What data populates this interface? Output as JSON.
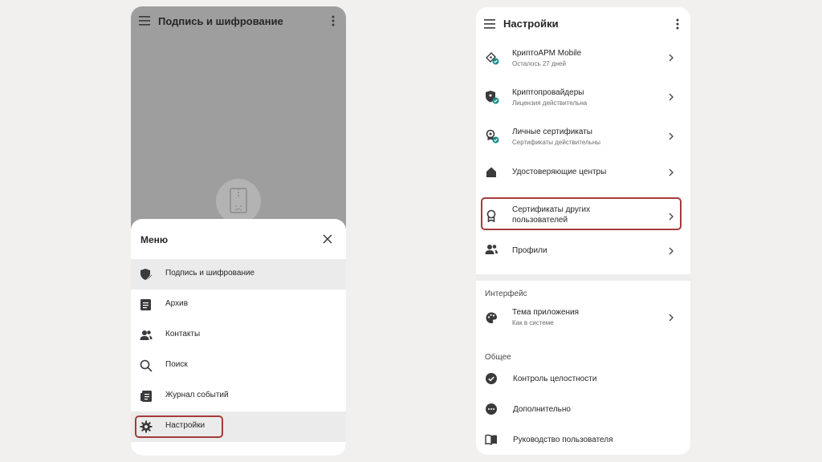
{
  "left": {
    "header": {
      "title": "Подпись и шифрование"
    },
    "menu": {
      "title": "Меню",
      "items": [
        {
          "label": "Подпись и шифрование",
          "icon": "shield-pen-icon"
        },
        {
          "label": "Архив",
          "icon": "archive-icon"
        },
        {
          "label": "Контакты",
          "icon": "contacts-icon"
        },
        {
          "label": "Поиск",
          "icon": "search-icon"
        },
        {
          "label": "Журнал событий",
          "icon": "event-log-icon"
        },
        {
          "label": "Настройки",
          "icon": "gear-icon"
        }
      ]
    }
  },
  "right": {
    "header": {
      "title": "Настройки"
    },
    "main_items": [
      {
        "title": "КриптоАРМ Mobile",
        "subtitle": "Осталось 27 дней",
        "icon": "key-check-icon"
      },
      {
        "title": "Криптопровайдеры",
        "subtitle": "Лицензия действительна",
        "icon": "shield-check-icon"
      },
      {
        "title": "Личные сертификаты",
        "subtitle": "Сертификаты действительны",
        "icon": "certificate-check-icon"
      },
      {
        "title": "Удостоверяющие центры",
        "subtitle": "",
        "icon": "home-icon"
      },
      {
        "title": "Сертификаты других",
        "title2": "пользователей",
        "icon": "ribbon-icon"
      },
      {
        "title": "Профили",
        "subtitle": "",
        "icon": "profiles-icon"
      }
    ],
    "interface": {
      "header": "Интерфейс",
      "items": [
        {
          "title": "Тема приложения",
          "subtitle": "Как в системе",
          "icon": "palette-icon"
        }
      ]
    },
    "general": {
      "header": "Общее",
      "items": [
        {
          "title": "Контроль целостности",
          "icon": "check-circle-icon"
        },
        {
          "title": "Дополнительно",
          "icon": "more-circle-icon"
        },
        {
          "title": "Руководство пользователя",
          "icon": "book-icon"
        }
      ]
    }
  },
  "colors": {
    "highlight": "#a63a3a",
    "badge": "#1e8a8a",
    "overlay": "#9e9e9e"
  }
}
